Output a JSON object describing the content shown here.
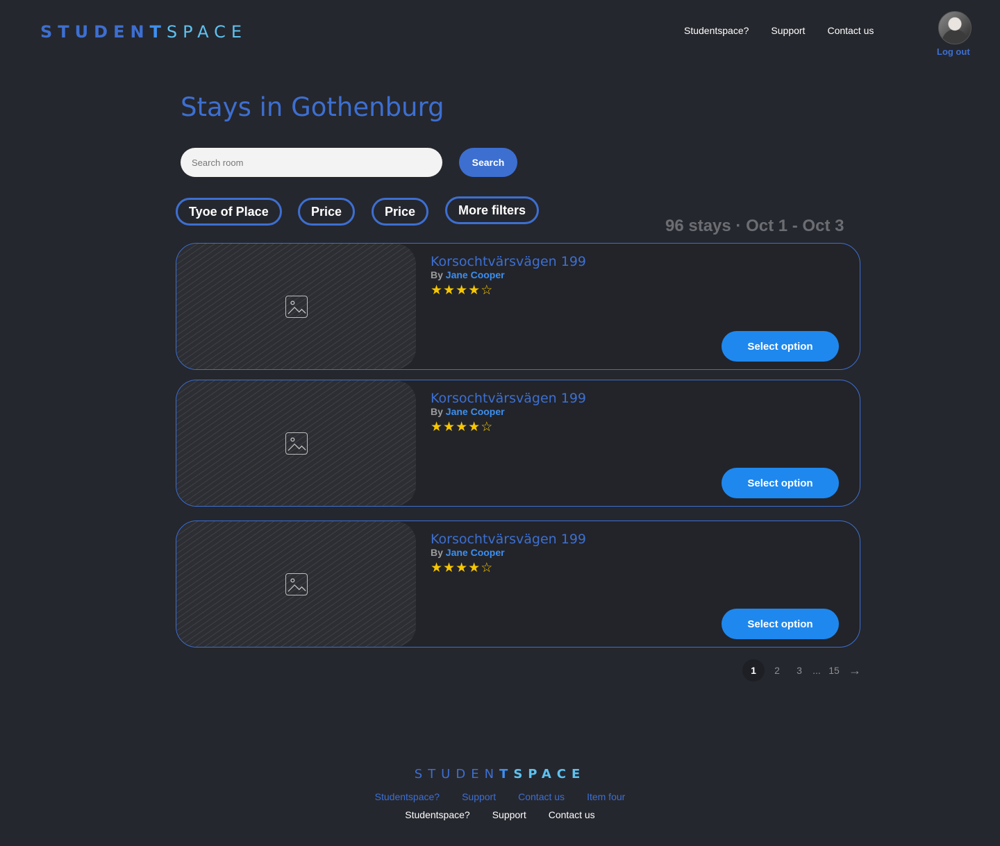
{
  "header": {
    "logo": {
      "part1": "STUDEN",
      "part2": "T",
      "part3": "SPACE"
    },
    "nav": [
      "Studentspace?",
      "Support",
      "Contact us"
    ],
    "logout": "Log out"
  },
  "page": {
    "title": "Stays in Gothenburg"
  },
  "search": {
    "placeholder": "Search room",
    "value": "",
    "button": "Search"
  },
  "filters": [
    "Tyoe of Place",
    "Price",
    "Price",
    "More filters"
  ],
  "summary": "96 stays · Oct 1 - Oct 3",
  "listings": [
    {
      "title": "Korsochtvärsvägen 199",
      "by": "By",
      "host": "Jane Cooper",
      "rating": 4,
      "max_rating": 5,
      "button": "Select option"
    },
    {
      "title": "Korsochtvärsvägen 199",
      "by": "By",
      "host": "Jane Cooper",
      "rating": 4,
      "max_rating": 5,
      "button": "Select option"
    },
    {
      "title": "Korsochtvärsvägen 199",
      "by": "By",
      "host": "Jane Cooper",
      "rating": 4,
      "max_rating": 5,
      "button": "Select option"
    }
  ],
  "pagination": {
    "pages": [
      "1",
      "2",
      "3",
      "...",
      "15"
    ],
    "current": "1"
  },
  "footer": {
    "logo": {
      "part1": "STUDEN",
      "part2": "T",
      "part3": "SPACE"
    },
    "links_row1": [
      "Studentspace?",
      "Support",
      "Contact us",
      "Item four"
    ],
    "links_row2": [
      "Studentspace?",
      "Support",
      "Contact us"
    ]
  },
  "colors": {
    "background": "#25272e",
    "primary": "#3d6fd1",
    "accent": "#1e88ef",
    "star": "#f7c600"
  },
  "icons": {
    "image_placeholder": "image-icon",
    "next_page": "arrow-right-icon",
    "star": "star-icon",
    "avatar": "user-avatar"
  }
}
